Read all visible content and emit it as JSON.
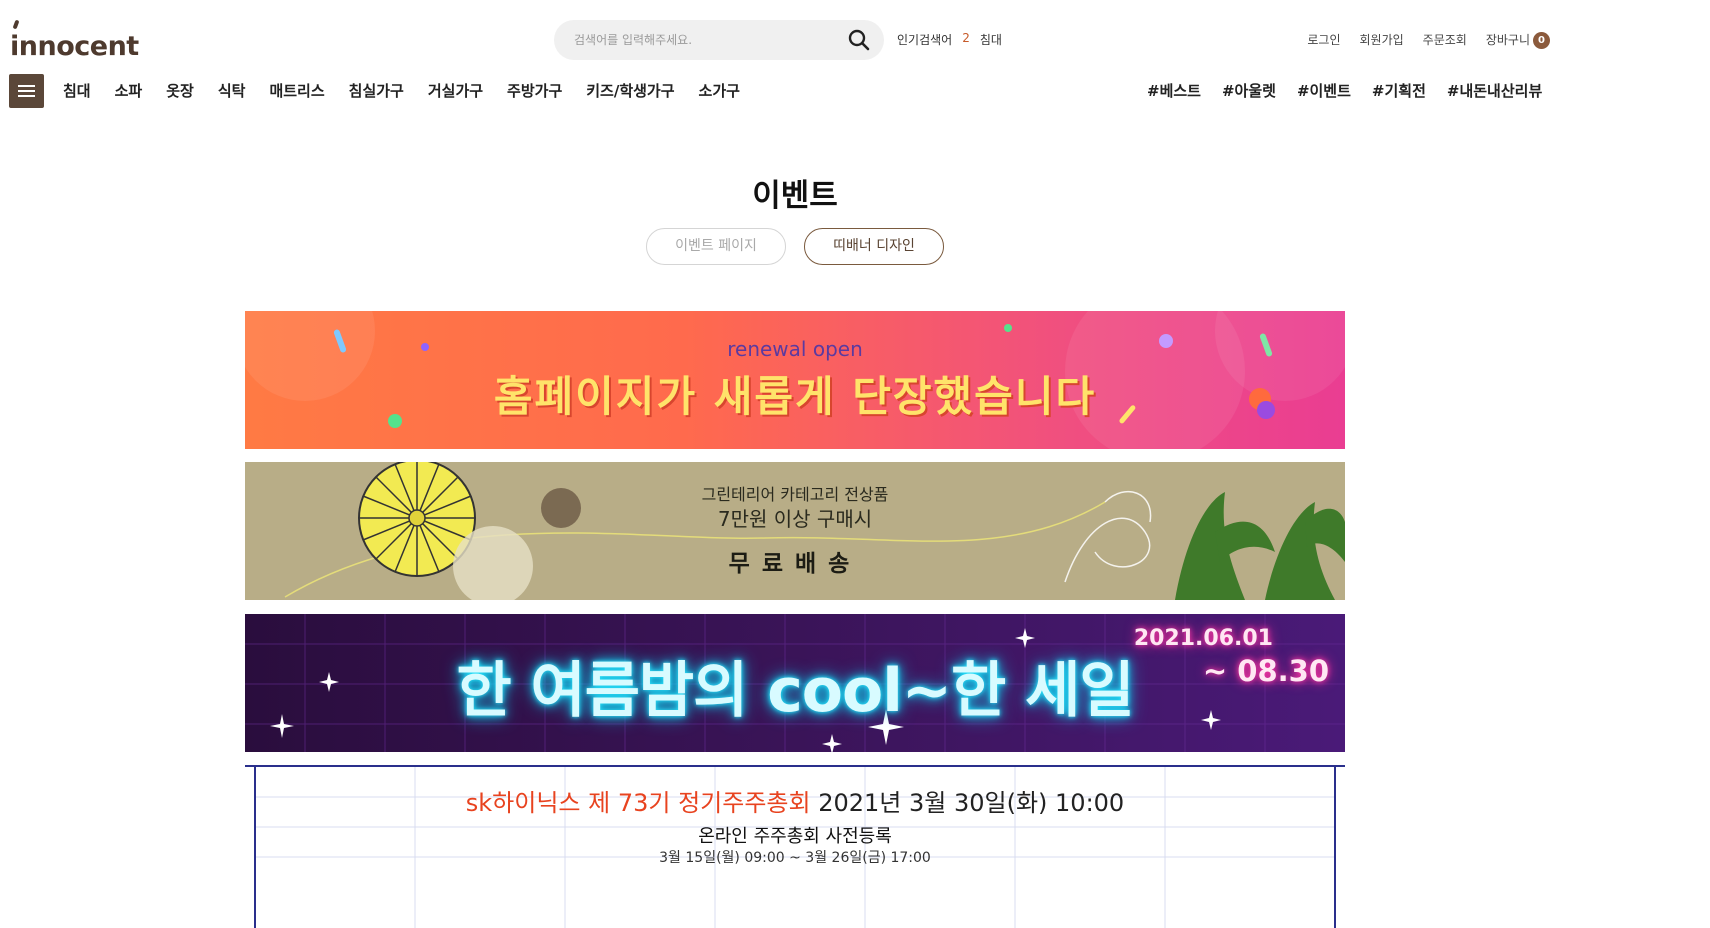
{
  "header": {
    "logo_text": "innocent",
    "search": {
      "placeholder": "검색어를 입력해주세요."
    },
    "popular": {
      "label": "인기검색어",
      "rank": "2",
      "keyword": "침대"
    },
    "util": {
      "login": "로그인",
      "signup": "회원가입",
      "orders": "주문조회",
      "cart": "장바구니",
      "cart_count": "0"
    }
  },
  "nav": {
    "categories": [
      "침대",
      "소파",
      "옷장",
      "식탁",
      "매트리스",
      "침실가구",
      "거실가구",
      "주방가구",
      "키즈/학생가구",
      "소가구"
    ],
    "hashtags": [
      "#베스트",
      "#아울렛",
      "#이벤트",
      "#기획전",
      "#내돈내산리뷰"
    ]
  },
  "page": {
    "title": "이벤트",
    "tabs": [
      {
        "label": "이벤트 페이지",
        "active": false
      },
      {
        "label": "띠배너 디자인",
        "active": true
      }
    ]
  },
  "banners": {
    "b1": {
      "sub": "renewal open",
      "main": "홈페이지가 새롭게 단장했습니다"
    },
    "b2": {
      "line1": "그린테리어 카테고리 전상품",
      "line2": "7만원 이상 구매시",
      "line3": "무료배송"
    },
    "b3": {
      "main": "한 여름밤의 cool~한 세일",
      "date_start": "2021.06.01",
      "date_end": "~ 08.30"
    },
    "b4": {
      "title_red": "sk하이닉스 제 73기 정기주주총회",
      "title_rest": " 2021년 3월 30일(화) 10:00",
      "line2": "온라인 주주총회 사전등록",
      "line3": "3월 15일(월) 09:00 ~ 3월 26일(금) 17:00"
    }
  },
  "colors": {
    "brand": "#4e3a2e",
    "menu_button": "#5b4739",
    "accent_rank": "#c75b2a"
  }
}
